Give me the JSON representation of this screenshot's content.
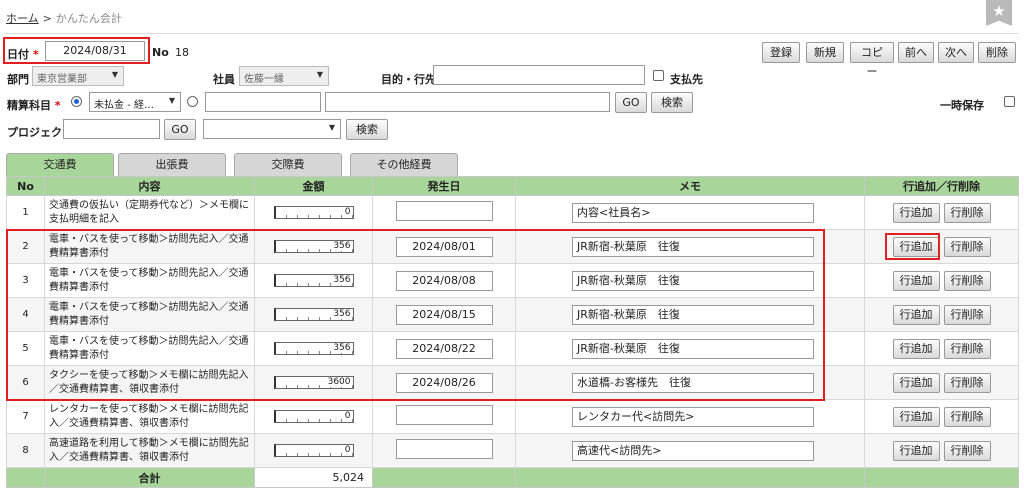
{
  "breadcrumb": {
    "home": "ホーム",
    "separator": ">",
    "current": "かんたん会計"
  },
  "star": "★",
  "header": {
    "date_label": "日付",
    "required_mark": "*",
    "date_value": "2024/08/31",
    "no_label": "No",
    "no_value": "18",
    "actions": [
      "登録",
      "新規",
      "コピー",
      "前へ",
      "次へ",
      "削除"
    ]
  },
  "dept": {
    "label": "部門",
    "value": "東京営業部"
  },
  "employee": {
    "label": "社員",
    "value": "佐藤一縁"
  },
  "purpose": {
    "label": "目的・行先",
    "value": ""
  },
  "payee": {
    "label": "支払先"
  },
  "account": {
    "label": "精算科目",
    "required_mark": "*",
    "select_value": "未払金 - 経…",
    "code_value": "",
    "name_value": "",
    "go": "GO",
    "search": "検索"
  },
  "hold": {
    "label": "一時保存"
  },
  "project": {
    "label": "プロジェクト",
    "value": "",
    "go": "GO",
    "select_value": "",
    "search": "検索"
  },
  "tabs": [
    "交通費",
    "出張費",
    "交際費",
    "その他経費"
  ],
  "table": {
    "headers": [
      "No",
      "内容",
      "金額",
      "発生日",
      "メモ",
      "行追加／行削除"
    ],
    "add_label": "行追加",
    "del_label": "行削除",
    "rows": [
      {
        "no": "1",
        "desc": "交通費の仮払い（定期券代など）＞メモ欄に支払明細を記入",
        "amount": "0",
        "date": "",
        "memo": "内容<社員名>"
      },
      {
        "no": "2",
        "desc": "電車・バスを使って移動＞訪問先記入／交通費精算書添付",
        "amount": "356",
        "date": "2024/08/01",
        "memo": "JR新宿-秋葉原　往復"
      },
      {
        "no": "3",
        "desc": "電車・バスを使って移動＞訪問先記入／交通費精算書添付",
        "amount": "356",
        "date": "2024/08/08",
        "memo": "JR新宿-秋葉原　往復"
      },
      {
        "no": "4",
        "desc": "電車・バスを使って移動＞訪問先記入／交通費精算書添付",
        "amount": "356",
        "date": "2024/08/15",
        "memo": "JR新宿-秋葉原　往復"
      },
      {
        "no": "5",
        "desc": "電車・バスを使って移動＞訪問先記入／交通費精算書添付",
        "amount": "356",
        "date": "2024/08/22",
        "memo": "JR新宿-秋葉原　往復"
      },
      {
        "no": "6",
        "desc": "タクシーを使って移動＞メモ欄に訪問先記入／交通費精算書、領収書添付",
        "amount": "3600",
        "date": "2024/08/26",
        "memo": "水道橋-お客様先　往復"
      },
      {
        "no": "7",
        "desc": "レンタカーを使って移動＞メモ欄に訪問先記入／交通費精算書、領収書添付",
        "amount": "0",
        "date": "",
        "memo": "レンタカー代<訪問先>"
      },
      {
        "no": "8",
        "desc": "高速道路を利用して移動＞メモ欄に訪問先記入／交通費精算書、領収書添付",
        "amount": "0",
        "date": "",
        "memo": "高速代<訪問先>"
      }
    ],
    "total_label": "合計",
    "total_value": "5,024"
  },
  "colors": {
    "header_green": "#a8d59a",
    "highlight_red": "#e02020",
    "radio_blue": "#1a62d6"
  }
}
